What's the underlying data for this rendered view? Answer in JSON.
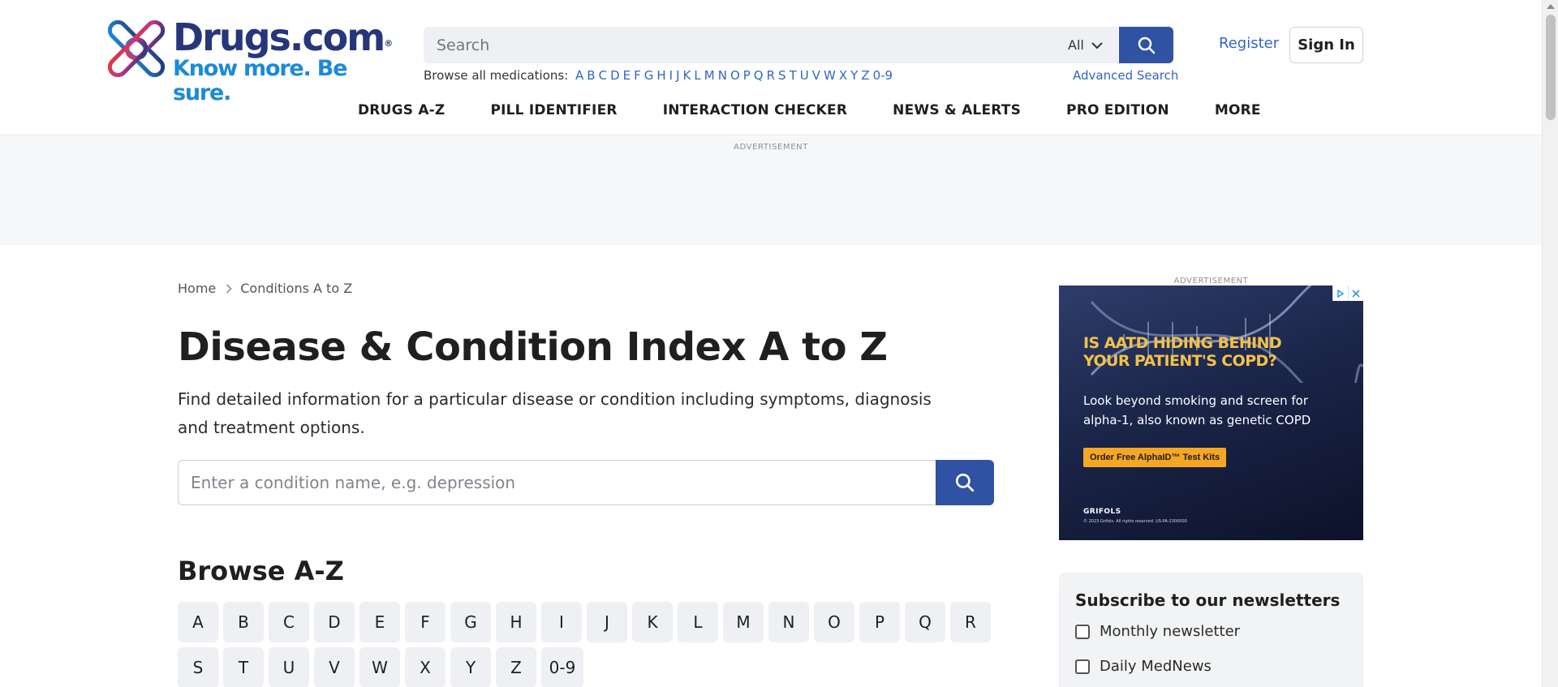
{
  "header": {
    "logo_name": "Drugs.com",
    "logo_reg": "®",
    "logo_tagline": "Know more. Be sure.",
    "search_placeholder": "Search",
    "search_scope": "All",
    "browse_label": "Browse all medications:",
    "browse_letters": [
      "A",
      "B",
      "C",
      "D",
      "E",
      "F",
      "G",
      "H",
      "I",
      "J",
      "K",
      "L",
      "M",
      "N",
      "O",
      "P",
      "Q",
      "R",
      "S",
      "T",
      "U",
      "V",
      "W",
      "X",
      "Y",
      "Z",
      "0-9"
    ],
    "advanced_search": "Advanced Search",
    "register": "Register",
    "sign_in": "Sign In"
  },
  "nav": [
    "DRUGS A-Z",
    "PILL IDENTIFIER",
    "INTERACTION CHECKER",
    "NEWS & ALERTS",
    "PRO EDITION",
    "MORE"
  ],
  "top_ad": {
    "label": "ADVERTISEMENT"
  },
  "breadcrumb": {
    "home": "Home",
    "current": "Conditions A to Z"
  },
  "main": {
    "title": "Disease & Condition Index A to Z",
    "intro": "Find detailed information for a particular disease or condition including symptoms, diagnosis and treatment options.",
    "search_placeholder": "Enter a condition name, e.g. depression",
    "browse_title": "Browse A-Z",
    "az": [
      "A",
      "B",
      "C",
      "D",
      "E",
      "F",
      "G",
      "H",
      "I",
      "J",
      "K",
      "L",
      "M",
      "N",
      "O",
      "P",
      "Q",
      "R",
      "S",
      "T",
      "U",
      "V",
      "W",
      "X",
      "Y",
      "Z",
      "0-9"
    ]
  },
  "side_ad": {
    "label": "ADVERTISEMENT",
    "headline": "IS AATD HIDING BEHIND YOUR PATIENT'S COPD?",
    "body": "Look beyond smoking and screen for alpha-1, also known as genetic COPD",
    "cta": "Order Free AlphaID™ Test Kits",
    "brand": "GRIFOLS",
    "fine_print": "© 2023 Grifols. All rights reserved. US-PA-2300000"
  },
  "newsletter": {
    "title": "Subscribe to our newsletters",
    "options": [
      "Monthly newsletter",
      "Daily MedNews"
    ]
  },
  "colors": {
    "brand_navy": "#27367a",
    "brand_blue": "#1d8ad6",
    "button_blue": "#2f52a3",
    "link_blue": "#2f66c4"
  }
}
